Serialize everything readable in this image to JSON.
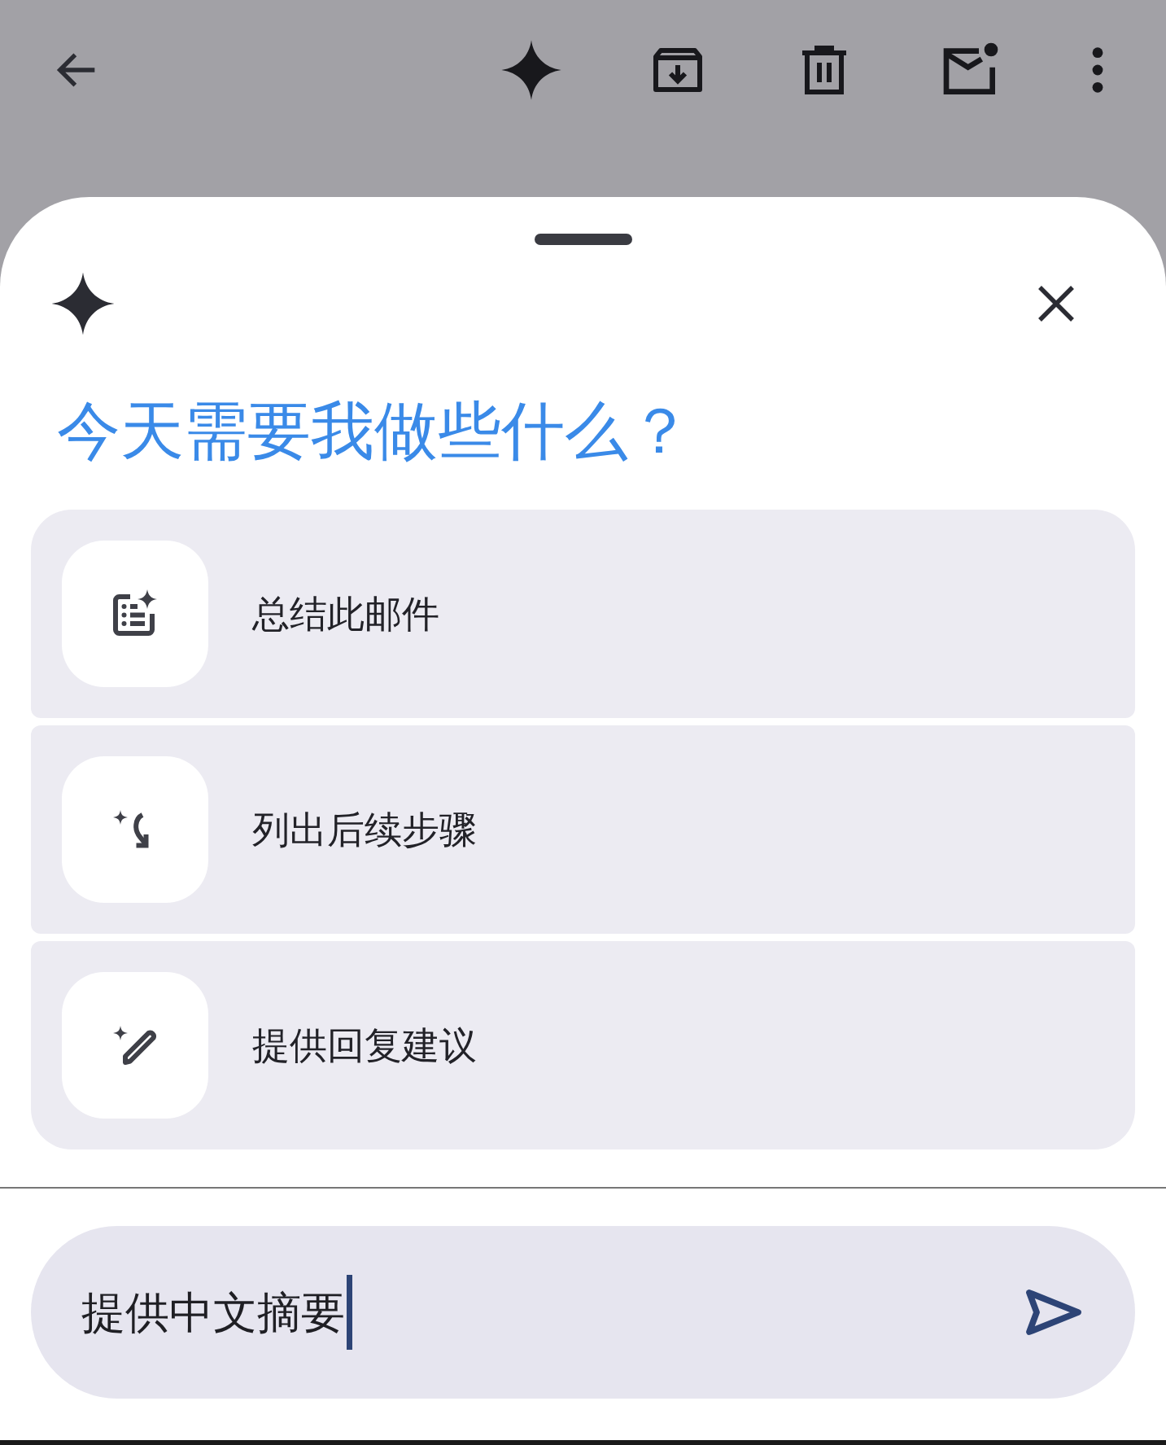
{
  "sheet": {
    "heading": "今天需要我做些什么？"
  },
  "suggestions": [
    {
      "kind": "summary",
      "label": "总结此邮件"
    },
    {
      "kind": "steps",
      "label": "列出后续步骤"
    },
    {
      "kind": "reply",
      "label": "提供回复建议"
    }
  ],
  "prompt": {
    "value": "提供中文摘要",
    "focused": true
  }
}
